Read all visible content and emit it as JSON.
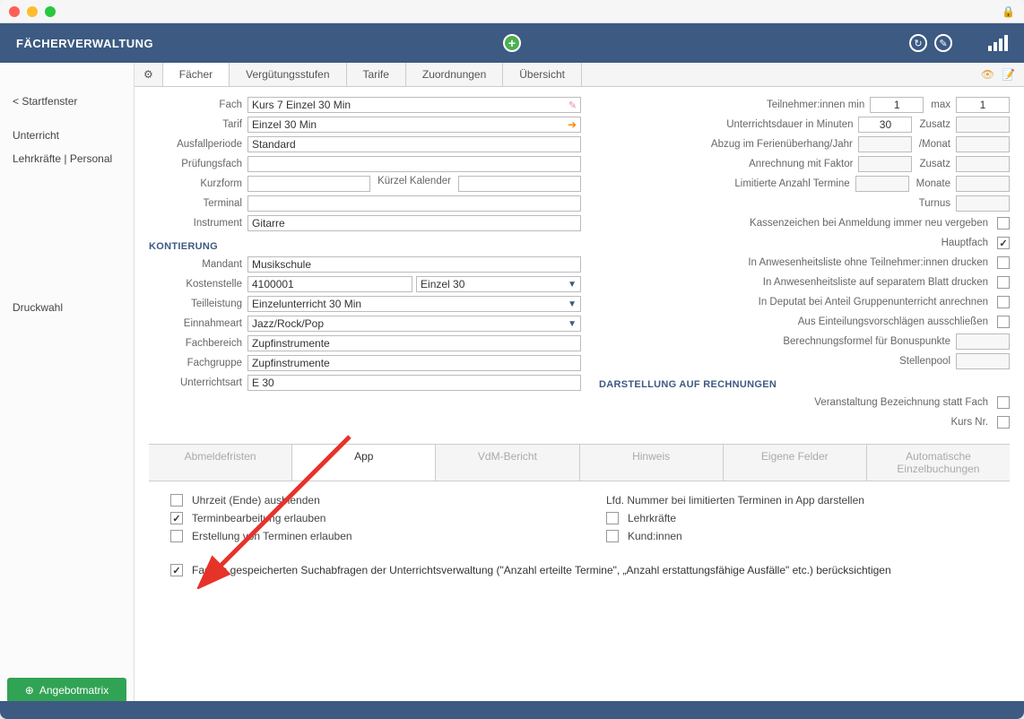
{
  "header": {
    "title": "FÄCHERVERWALTUNG"
  },
  "sidebar": {
    "back": "< Startfenster",
    "items": [
      "Unterricht",
      "Lehrkräfte | Personal"
    ],
    "druckwahl": "Druckwahl",
    "angebot": "Angebotmatrix"
  },
  "tabs": [
    "Fächer",
    "Vergütungsstufen",
    "Tarife",
    "Zuordnungen",
    "Übersicht"
  ],
  "form": {
    "fach_l": "Fach",
    "fach": "Kurs 7 Einzel 30 Min",
    "tarif_l": "Tarif",
    "tarif": "Einzel 30 Min",
    "ausfall_l": "Ausfallperiode",
    "ausfall": "Standard",
    "pruef_l": "Prüfungsfach",
    "kurz_l": "Kurzform",
    "kuerzel_l": "Kürzel Kalender",
    "terminal_l": "Terminal",
    "instr_l": "Instrument",
    "instr": "Gitarre",
    "kontierung_h": "KONTIERUNG",
    "mandant_l": "Mandant",
    "mandant": "Musikschule",
    "kosten_l": "Kostenstelle",
    "kosten1": "4100001",
    "kosten2": "Einzel 30",
    "teil_l": "Teilleistung",
    "teil": "Einzelunterricht 30 Min",
    "einnahme_l": "Einnahmeart",
    "einnahme": "Jazz/Rock/Pop",
    "bereich_l": "Fachbereich",
    "bereich": "Zupfinstrumente",
    "gruppe_l": "Fachgruppe",
    "gruppe": "Zupfinstrumente",
    "uart_l": "Unterrichtsart",
    "uart": "E 30"
  },
  "right": {
    "teiln_l": "Teilnehmer:innen min",
    "teiln": "1",
    "max_l": "max",
    "max": "1",
    "dauer_l": "Unterrichtsdauer in Minuten",
    "dauer": "30",
    "zusatz_l": "Zusatz",
    "abzug_l": "Abzug im Ferienüberhang/Jahr",
    "monat_l": "/Monat",
    "faktor_l": "Anrechnung mit Faktor",
    "zusatz2_l": "Zusatz",
    "limit_l": "Limitierte Anzahl     Termine",
    "monate_l": "Monate",
    "turnus_l": "Turnus",
    "chk1": "Kassenzeichen bei Anmeldung immer neu vergeben",
    "chk2": "Hauptfach",
    "chk3": "In Anwesenheitsliste ohne Teilnehmer:innen drucken",
    "chk4": "In Anwesenheitsliste auf separatem Blatt drucken",
    "chk5": "In Deputat bei Anteil Gruppenunterricht anrechnen",
    "chk6": "Aus Einteilungsvorschlägen ausschließen",
    "chk7": "Berechnungsformel für Bonuspunkte",
    "chk8": "Stellenpool",
    "darst_h": "DARSTELLUNG AUF RECHNUNGEN",
    "chk9": "Veranstaltung Bezeichnung statt Fach",
    "chk10": "Kurs Nr."
  },
  "subtabs": [
    "Abmeldefristen",
    "App",
    "VdM-Bericht",
    "Hinweis",
    "Eigene Felder",
    "Automatische Einzelbuchungen"
  ],
  "app": {
    "c1": "Uhrzeit (Ende) ausblenden",
    "c2": "Terminbearbeitung erlauben",
    "c3": "Erstellung von Terminen erlauben",
    "r1": "Lfd. Nummer bei limitierten Terminen in App darstellen",
    "r2": "Lehrkräfte",
    "r3": "Kund:innen",
    "long": "Fach in gespeicherten Suchabfragen der Unterrichtsverwaltung (\"Anzahl erteilte Termine\", „Anzahl erstattungsfähige Ausfälle\" etc.) berücksichtigen"
  }
}
